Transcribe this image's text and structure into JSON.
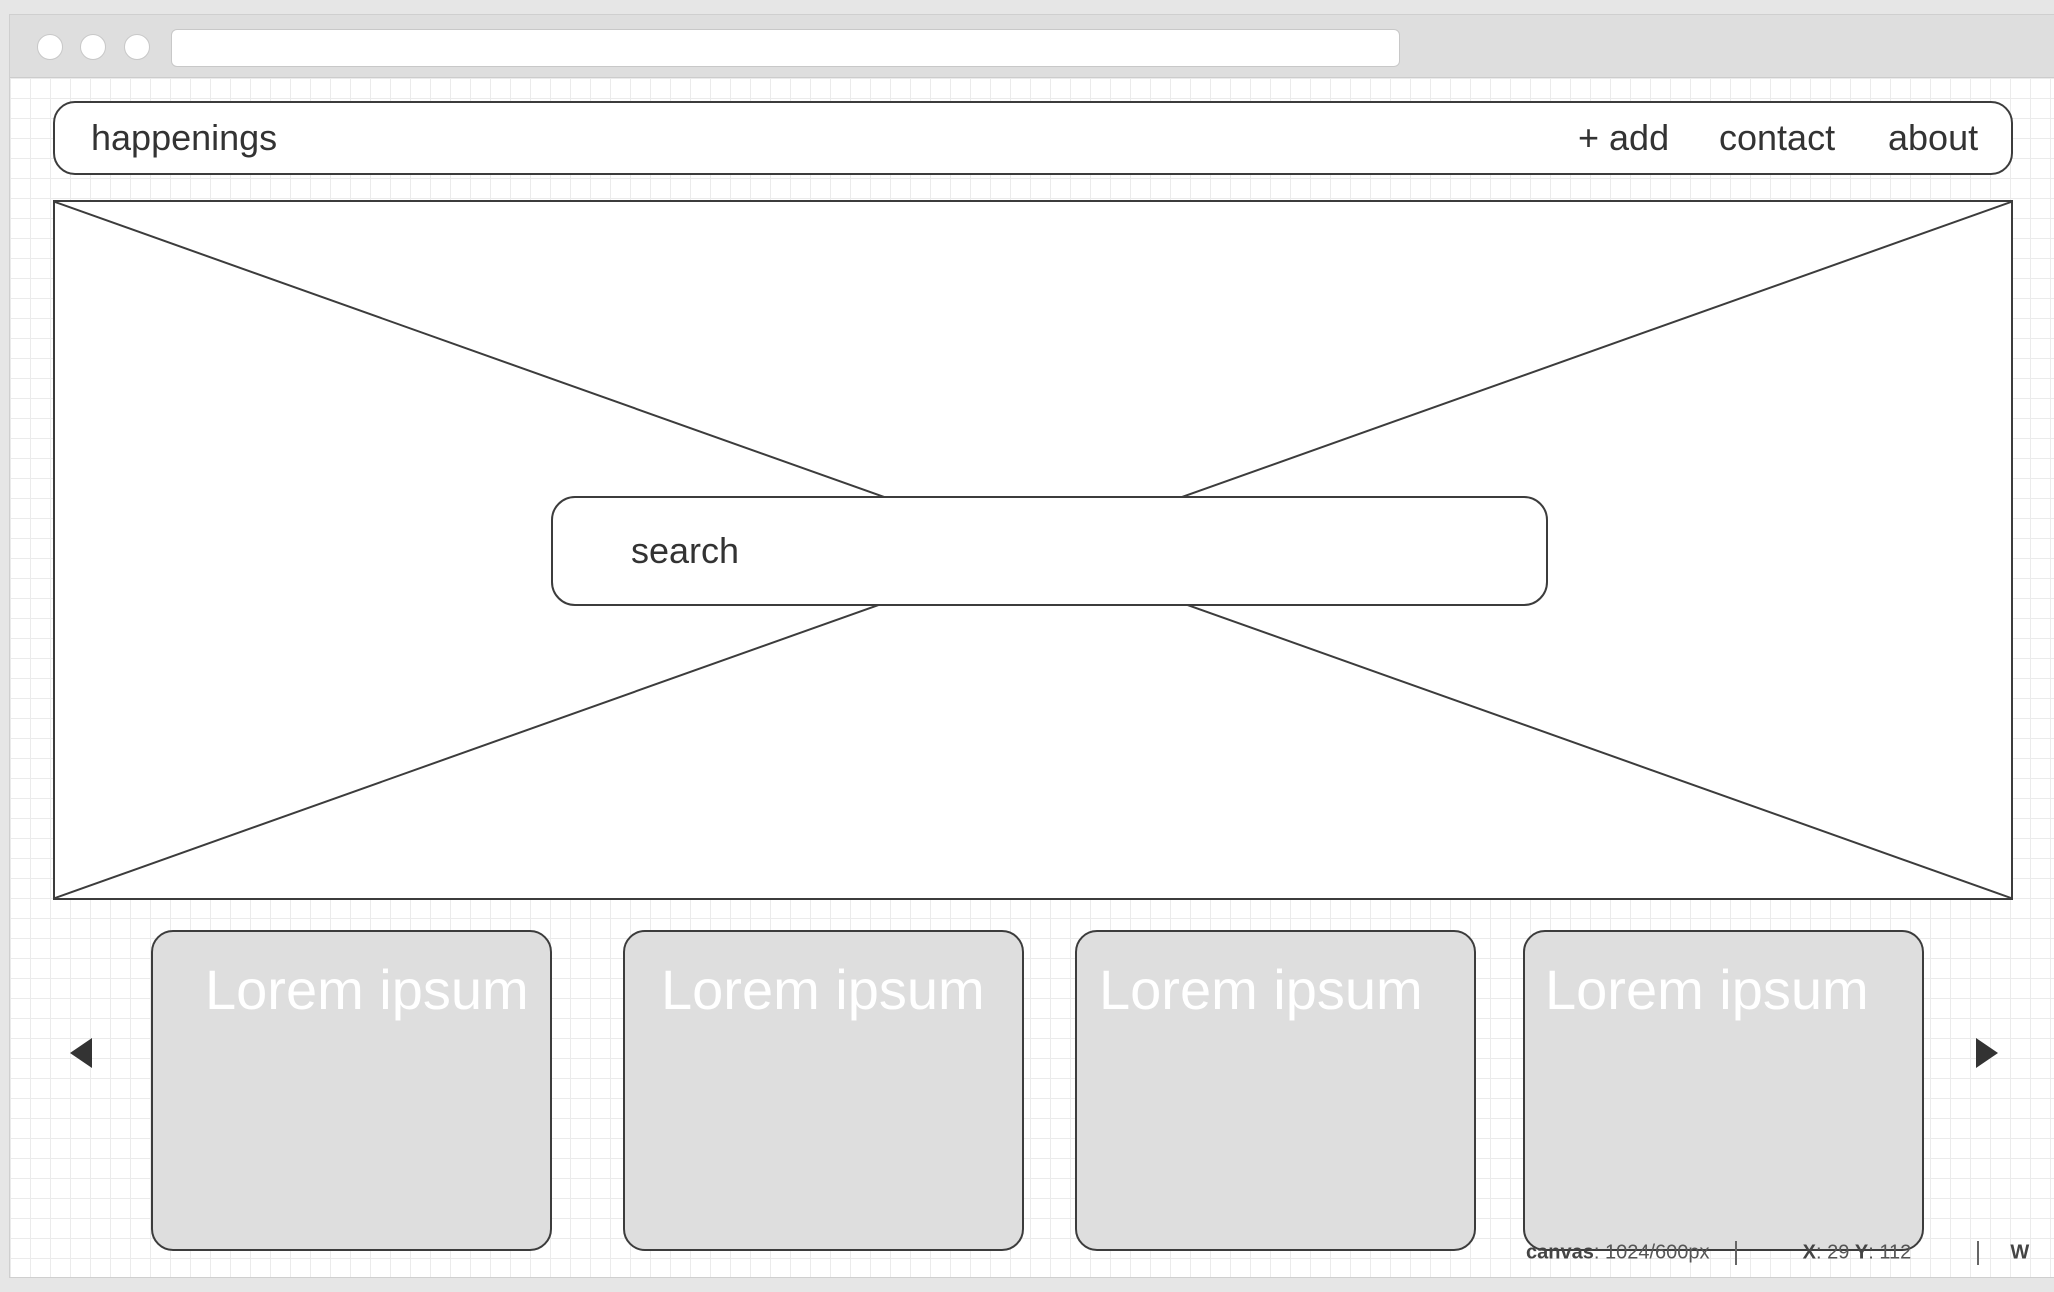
{
  "navbar": {
    "brand": "happenings",
    "links": [
      "+ add",
      "contact",
      "about"
    ]
  },
  "hero": {
    "search_placeholder": "search"
  },
  "cards": [
    {
      "title": "Lorem ipsum"
    },
    {
      "title": "Lorem ipsum"
    },
    {
      "title": "Lorem ipsum"
    },
    {
      "title": "Lorem ipsum"
    }
  ],
  "carousel": {
    "prev_icon": "triangle-left-icon",
    "next_icon": "triangle-right-icon"
  },
  "statusbar": {
    "canvas_label": "canvas",
    "canvas_value": ": 1024/600px",
    "x_label": "X",
    "x_value": ": 29",
    "y_label": "Y",
    "y_value": ": 112",
    "w_label": "W"
  }
}
